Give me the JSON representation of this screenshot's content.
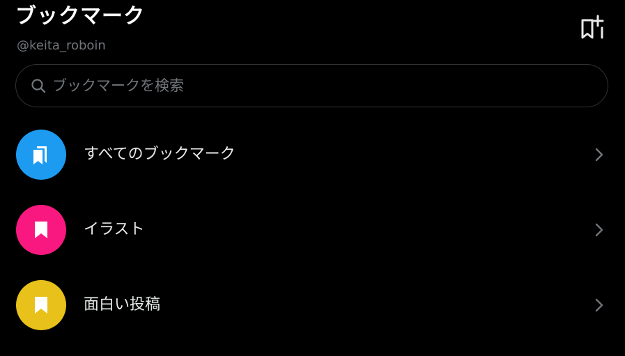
{
  "header": {
    "title": "ブックマーク",
    "handle": "@keita_roboin",
    "new_folder_icon": "bookmark-plus-icon"
  },
  "search": {
    "placeholder": "ブックマークを検索",
    "value": "",
    "icon": "search-icon"
  },
  "folders": [
    {
      "label": "すべてのブックマーク",
      "color": "#1d9bf0",
      "icon": "bookmarks-stack-icon"
    },
    {
      "label": "イラスト",
      "color": "#f91880",
      "icon": "bookmark-icon"
    },
    {
      "label": "面白い投稿",
      "color": "#e8c21a",
      "icon": "bookmark-icon"
    }
  ],
  "colors": {
    "background": "#000000",
    "text_primary": "#e7e9ea",
    "text_secondary": "#71767b",
    "border": "#2f3336"
  }
}
